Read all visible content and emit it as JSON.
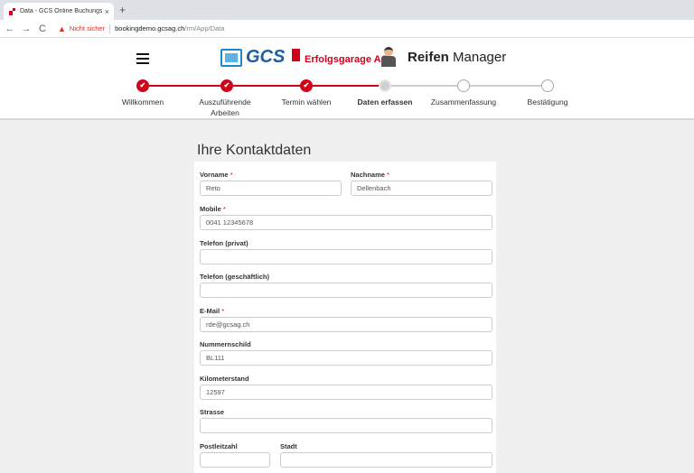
{
  "browser": {
    "tab_title": "Data - GCS Online Buchungssyst",
    "tab_close": "×",
    "new_tab": "+",
    "back": "←",
    "forward": "→",
    "reload": "C",
    "warning_icon": "▲",
    "not_secure": "Nicht sicher",
    "url_host": "bookingdemo.gcsag.ch",
    "url_path": "/rm/App/Data"
  },
  "header": {
    "logo_gcs": "GCS",
    "logo_company": "Erfolgsgarage AG",
    "app_title_bold": "Reifen",
    "app_title_rest": "Manager",
    "accent_color": "#d0021b"
  },
  "stepper": {
    "check": "✔",
    "steps": [
      {
        "label": "Willkommen",
        "state": "done"
      },
      {
        "label": "Auszuführende Arbeiten",
        "state": "done"
      },
      {
        "label": "Termin wählen",
        "state": "done"
      },
      {
        "label": "Daten erfassen",
        "state": "current"
      },
      {
        "label": "Zusammenfassung",
        "state": "todo"
      },
      {
        "label": "Bestätigung",
        "state": "todo"
      }
    ]
  },
  "form": {
    "title": "Ihre Kontaktdaten",
    "required_mark": "*",
    "vorname": {
      "label": "Vorname",
      "value": "Reto"
    },
    "nachname": {
      "label": "Nachname",
      "value": "Dellenbach"
    },
    "mobile": {
      "label": "Mobile",
      "value": "0041 12345678"
    },
    "telefon_privat": {
      "label": "Telefon (privat)",
      "value": ""
    },
    "telefon_geschaeftlich": {
      "label": "Telefon (geschäftlich)",
      "value": ""
    },
    "email": {
      "label": "E-Mail",
      "value": "rde@gcsag.ch"
    },
    "nummernschild": {
      "label": "Nummernschild",
      "value": "BL111"
    },
    "kilometerstand": {
      "label": "Kilometerstand",
      "value": "12597"
    },
    "strasse": {
      "label": "Strasse",
      "value": ""
    },
    "postleitzahl": {
      "label": "Postleitzahl",
      "value": ""
    },
    "stadt": {
      "label": "Stadt",
      "value": ""
    }
  }
}
